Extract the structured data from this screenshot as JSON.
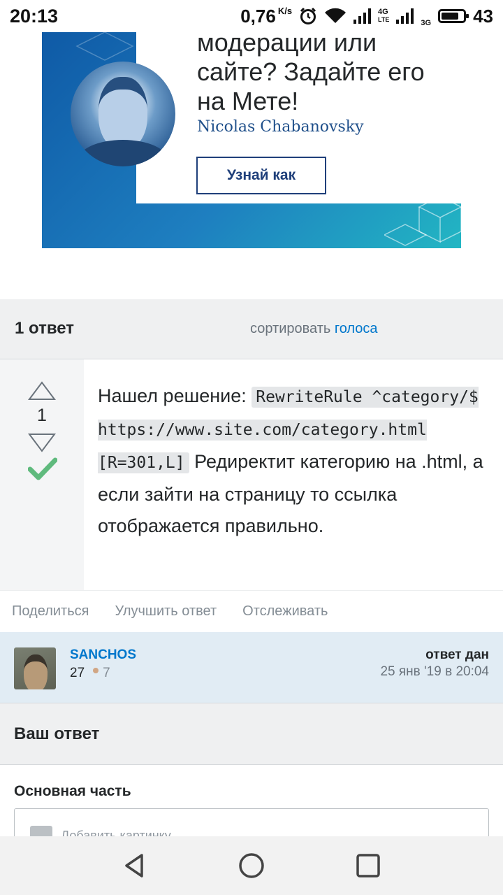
{
  "status_bar": {
    "time": "20:13",
    "speed": "0,76",
    "speed_unit": "K/s",
    "net1": "4G",
    "net1_sub": "LTE",
    "net2": "3G",
    "battery": "43"
  },
  "ad": {
    "headline": "модерации или сайте? Задайте его на Мете!",
    "author": "Nicolas Chabanovsky",
    "button": "Узнай как"
  },
  "answers_header": {
    "count": "1 ответ",
    "sort_label": "сортировать",
    "sort_value": "голоса"
  },
  "answer": {
    "votes": "1",
    "text_before": "Нашел решение: ",
    "code": "RewriteRule ^category/$ https://www.site.com/category.html [R=301,L]",
    "text_after": " Редиректит категорию на .html, а если зайти на страницу то ссылка отображается правильно."
  },
  "post_menu": {
    "share": "Поделиться",
    "improve": "Улучшить ответ",
    "follow": "Отслеживать"
  },
  "user_card": {
    "name": "SANCHOS",
    "reputation": "27",
    "bronze": "7",
    "answered_label": "ответ дан",
    "answered_date": "25 янв '19 в 20:04"
  },
  "your_answer": {
    "title": "Ваш ответ",
    "body_label": "Основная часть",
    "add_image": "Добавить картинку"
  },
  "colors": {
    "link": "#0077cc",
    "accepted": "#5fba7d",
    "header_bg": "#eff0f1",
    "user_card_bg": "#e1ecf4"
  }
}
